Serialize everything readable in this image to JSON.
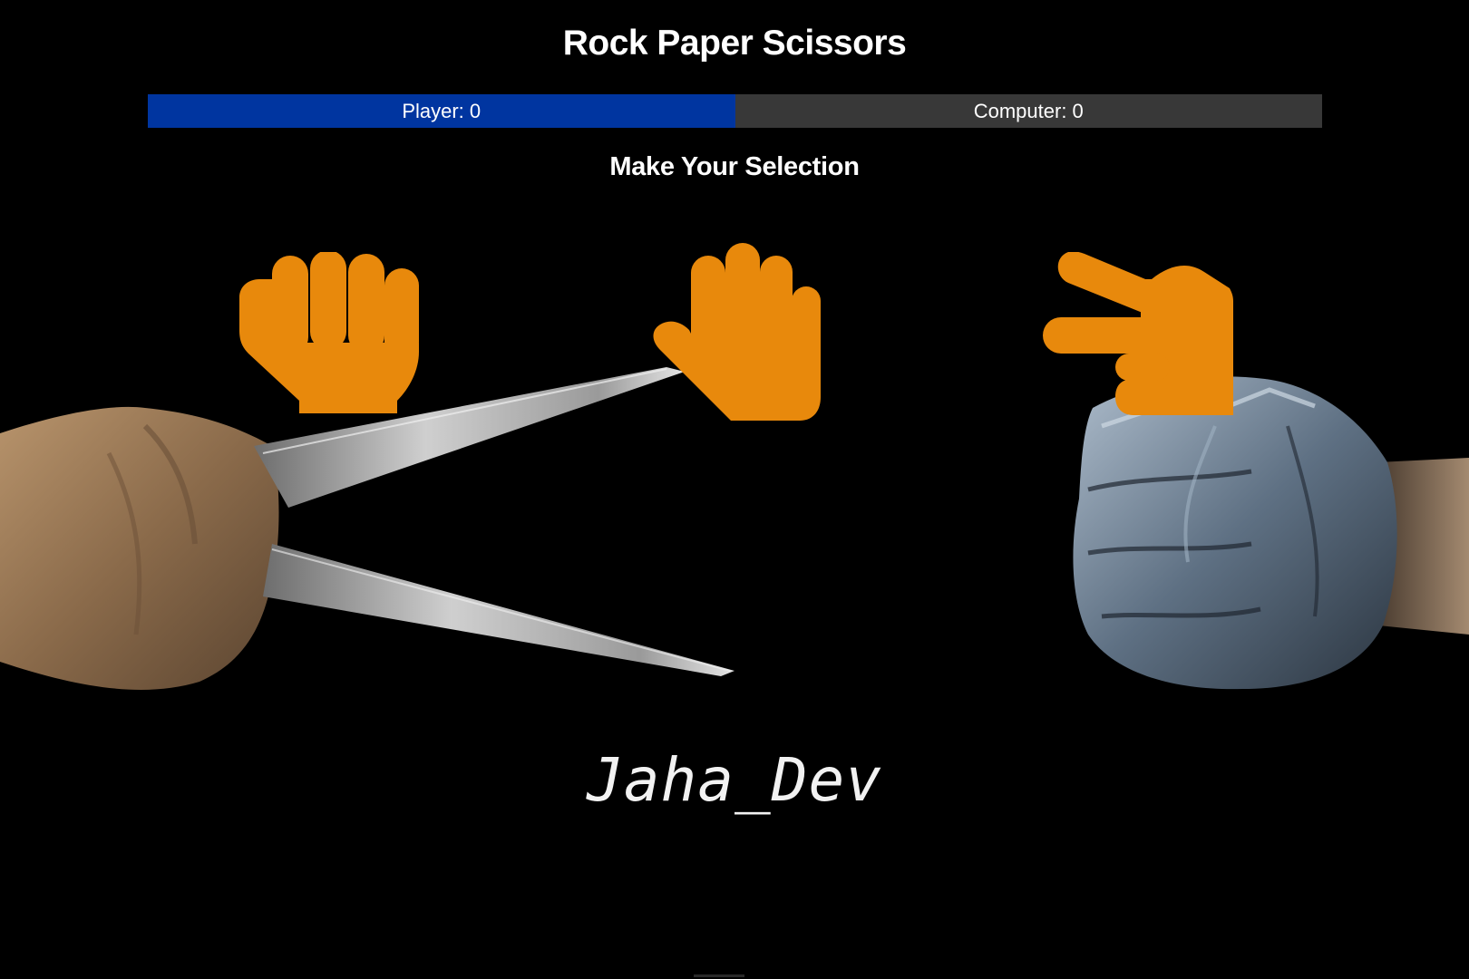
{
  "title": "Rock Paper Scissors",
  "scoreboard": {
    "player_label": "Player: 0",
    "computer_label": "Computer: 0"
  },
  "prompt": "Make Your Selection",
  "choices": [
    {
      "icon": "rock-fist-icon",
      "value": "rock"
    },
    {
      "icon": "paper-hand-icon",
      "value": "paper"
    },
    {
      "icon": "scissors-hand-icon",
      "value": "scissors"
    }
  ],
  "signature": "Jaha_Dev",
  "colors": {
    "background": "#000000",
    "player_bar": "#0035a0",
    "computer_bar": "#383838",
    "icon": "#e8890c",
    "text": "#ffffff"
  }
}
